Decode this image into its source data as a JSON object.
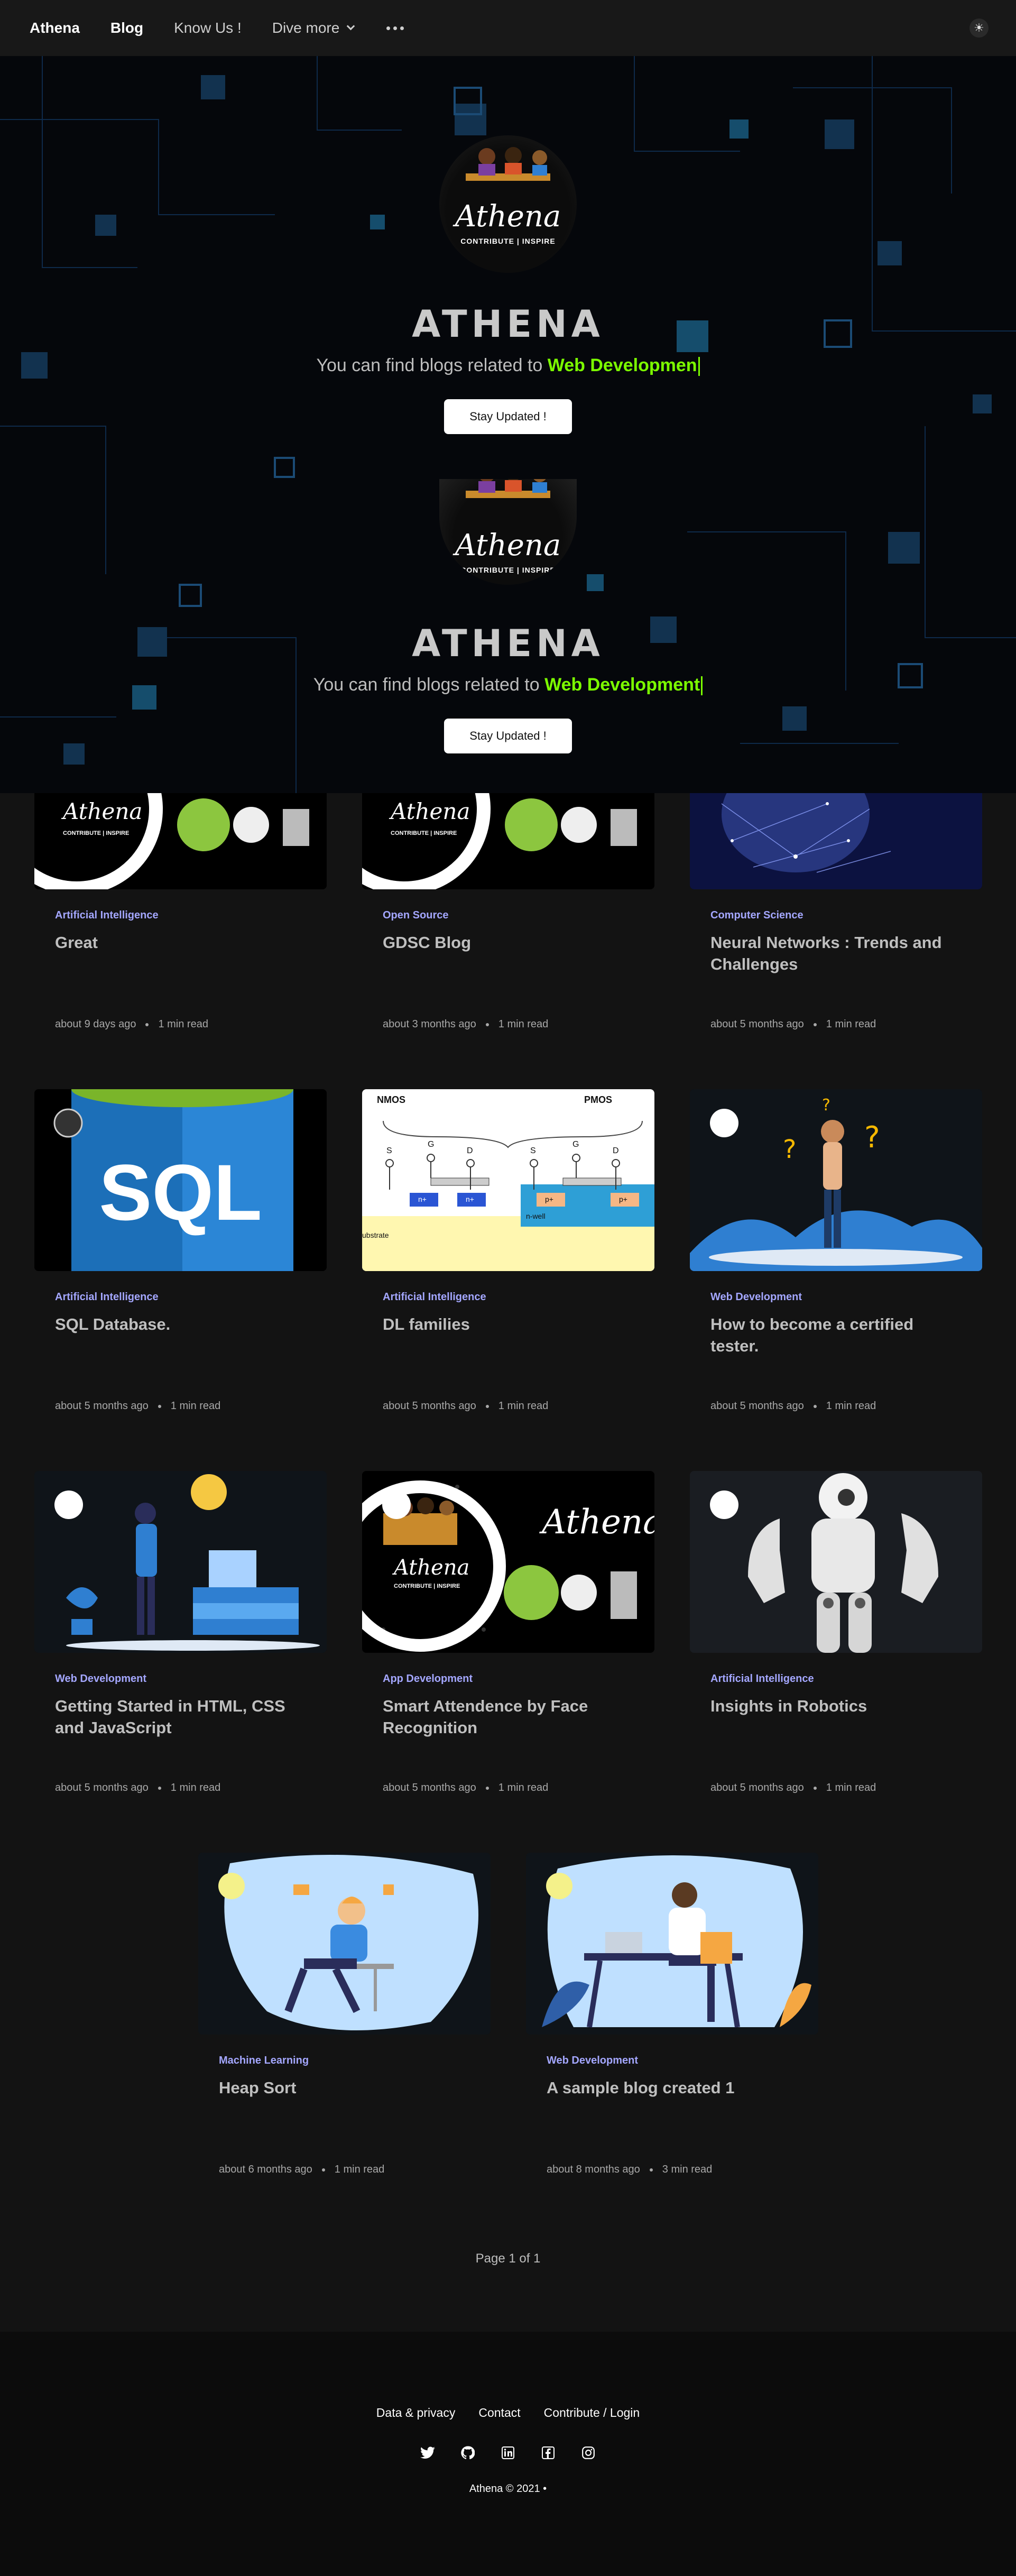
{
  "nav": {
    "brand": "Athena",
    "items": [
      {
        "label": "Blog"
      },
      {
        "label": "Know Us !"
      },
      {
        "label": "Dive more"
      }
    ],
    "more_icon": "ellipsis-icon",
    "theme_icon": "sun-icon"
  },
  "hero": {
    "logo": {
      "title": "Athena",
      "subtitle": "CONTRIBUTE | INSPIRE"
    },
    "title": "ATHENA",
    "first": {
      "prefix": "You can find blogs related to",
      "highlight": "Web Developmen"
    },
    "second": {
      "prefix": "You can find blogs related to",
      "highlight": "Web Development"
    },
    "button_label": "Stay Updated !",
    "highlight_color": "#7CFC00"
  },
  "posts": [
    {
      "category": "Artificial Intelligence",
      "title": "Great",
      "date": "about 9 days ago",
      "read": "1 min read"
    },
    {
      "category": "Open Source",
      "title": "GDSC Blog",
      "date": "about 3 months ago",
      "read": "1 min read"
    },
    {
      "category": "Computer Science",
      "title": "Neural Networks : Trends and Challenges",
      "date": "about 5 months ago",
      "read": "1 min read"
    },
    {
      "category": "Artificial Intelligence",
      "title": "SQL Database.",
      "date": "about 5 months ago",
      "read": "1 min read",
      "image_text": "SQL"
    },
    {
      "category": "Artificial Intelligence",
      "title": "DL families",
      "date": "about 5 months ago",
      "read": "1 min read",
      "image_labels": [
        "NMOS",
        "PMOS",
        "S",
        "G",
        "D",
        "S",
        "G",
        "D",
        "n+",
        "n+",
        "p+",
        "p+",
        "n-well",
        "ubstrate"
      ]
    },
    {
      "category": "Web Development",
      "title": "How to become a certified tester.",
      "date": "about 5 months ago",
      "read": "1 min read"
    },
    {
      "category": "Web Development",
      "title": "Getting Started in HTML, CSS and JavaScript",
      "date": "about 5 months ago",
      "read": "1 min read"
    },
    {
      "category": "App Development",
      "title": "Smart Attendence by Face Recognition",
      "date": "about 5 months ago",
      "read": "1 min read"
    },
    {
      "category": "Artificial Intelligence",
      "title": "Insights in Robotics",
      "date": "about 5 months ago",
      "read": "1 min read"
    },
    {
      "category": "Machine Learning",
      "title": "Heap Sort",
      "date": "about 6 months ago",
      "read": "1 min read"
    },
    {
      "category": "Web Development",
      "title": "A sample blog created 1",
      "date": "about 8 months ago",
      "read": "3 min read"
    }
  ],
  "pagination": "Page 1 of 1",
  "footer": {
    "links": [
      "Data & privacy",
      "Contact",
      "Contribute / Login"
    ],
    "socials": [
      "twitter-icon",
      "github-icon",
      "linkedin-icon",
      "facebook-icon",
      "instagram-icon"
    ],
    "copyright": "Athena © 2021  •"
  },
  "colors": {
    "category": "#a4a7ff",
    "background": "#131313",
    "accent": "#7CFC00"
  }
}
